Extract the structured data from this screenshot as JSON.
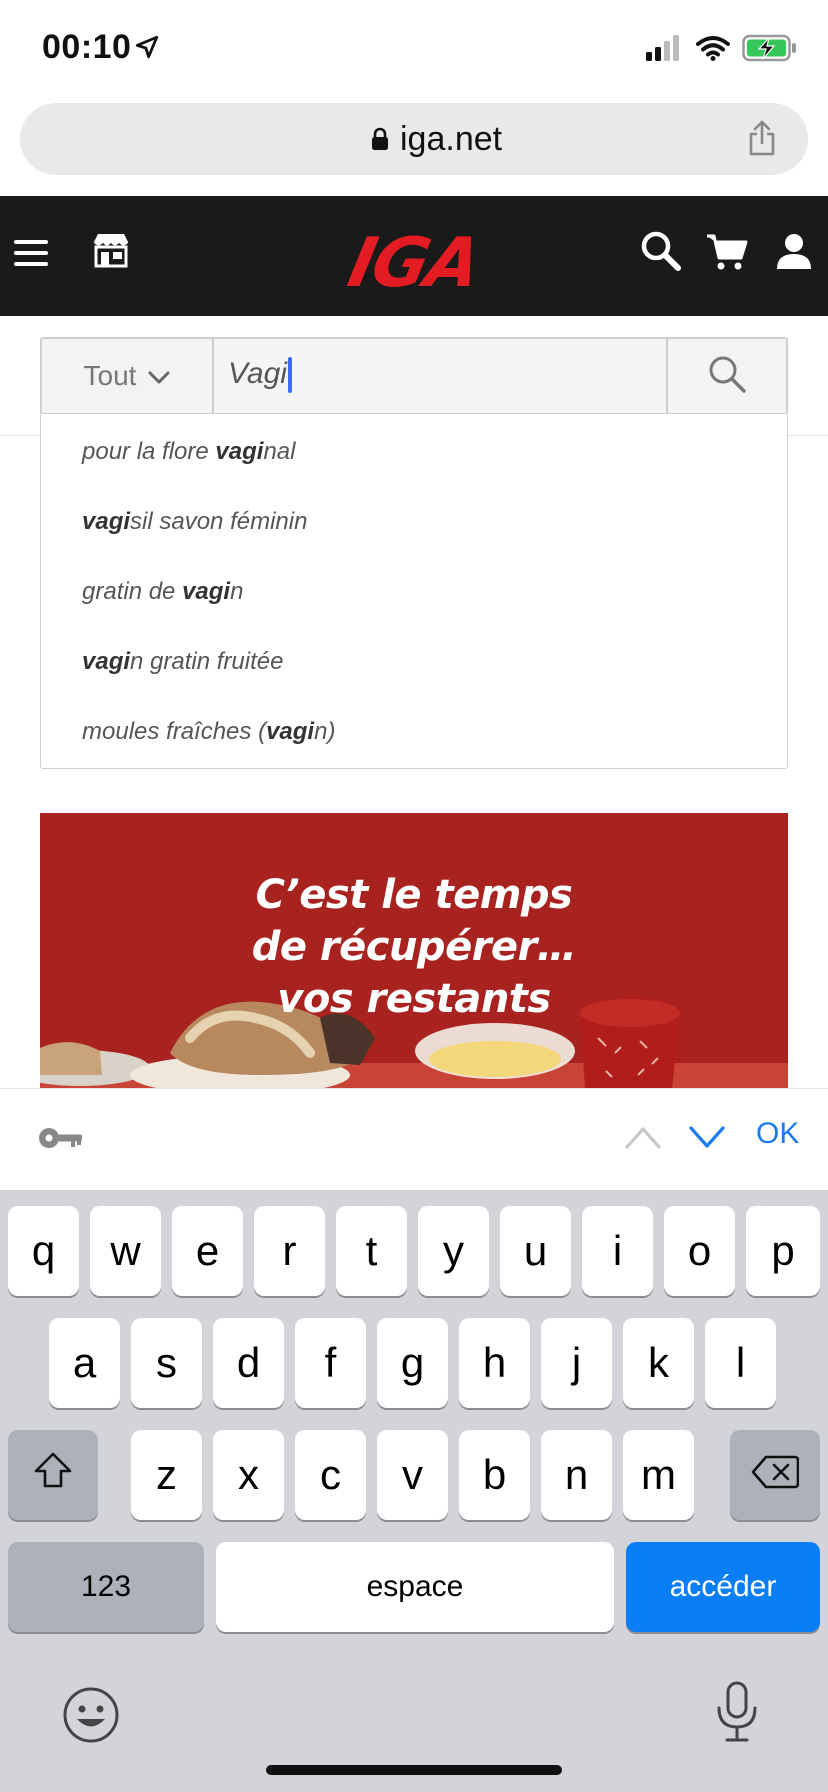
{
  "status_bar": {
    "time": "00:10"
  },
  "browser": {
    "url": "iga.net"
  },
  "header": {
    "logo": "IGA"
  },
  "search": {
    "scope": "Tout",
    "query": "Vagi"
  },
  "suggestions": [
    {
      "before": "pour la flore ",
      "bold": "vagi",
      "after": "nal"
    },
    {
      "before": "",
      "bold": "vagi",
      "after": "sil savon féminin"
    },
    {
      "before": "gratin de ",
      "bold": "vagi",
      "after": "n"
    },
    {
      "before": "",
      "bold": "vagi",
      "after": "n gratin fruitée"
    },
    {
      "before": "moules fraîches (",
      "bold": "vagi",
      "after": "n)"
    }
  ],
  "banner": {
    "line1": "C’est le temps",
    "line2": "de récupérer…",
    "line3": "vos restants"
  },
  "keyboard_accessory": {
    "done_label": "OK"
  },
  "keyboard": {
    "row1": [
      "q",
      "w",
      "e",
      "r",
      "t",
      "y",
      "u",
      "i",
      "o",
      "p"
    ],
    "row2": [
      "a",
      "s",
      "d",
      "f",
      "g",
      "h",
      "j",
      "k",
      "l"
    ],
    "row3": [
      "z",
      "x",
      "c",
      "v",
      "b",
      "n",
      "m"
    ],
    "numbers_label": "123",
    "space_label": "espace",
    "go_label": "accéder"
  },
  "colors": {
    "brand_red": "#e31b23",
    "accent_blue": "#0a7ff5"
  }
}
